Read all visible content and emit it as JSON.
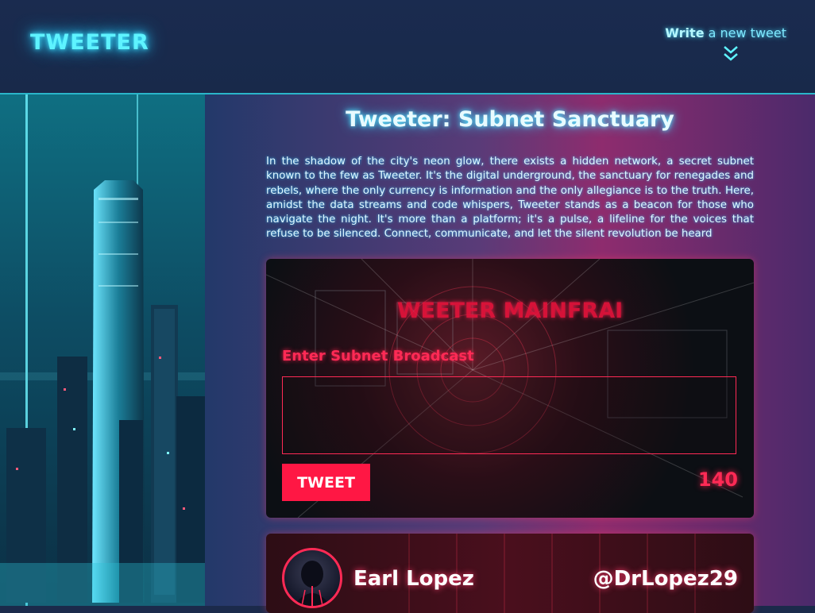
{
  "header": {
    "logo": "TWEETER",
    "write_strong": "Write",
    "write_rest": " a new tweet"
  },
  "main": {
    "title": "Tweeter: Subnet Sanctuary",
    "intro": "In the shadow of the city's neon glow, there exists a hidden network, a secret subnet known to the few as Tweeter. It's the digital underground, the sanctuary for renegades and rebels, where the only currency is information and the only allegiance is to the truth. Here, amidst the data streams and code whispers, Tweeter stands as a beacon for those who navigate the night. It's more than a platform; it's a pulse, a lifeline for the voices that refuse to be silenced. Connect, communicate, and let the silent revolution be heard"
  },
  "composer": {
    "heading": "WEETER MAINFRAI",
    "label": "Enter Subnet Broadcast",
    "input_value": "",
    "tweet_button": "TWEET",
    "char_count": "140"
  },
  "tweet": {
    "author_name": "Earl Lopez",
    "author_handle": "@DrLopez29"
  },
  "colors": {
    "accent_cyan": "#5ef3ff",
    "accent_red": "#ff1744",
    "header_bg": "#1a2b4f"
  },
  "icons": {
    "write_chevron": "double-chevron-down-icon"
  }
}
